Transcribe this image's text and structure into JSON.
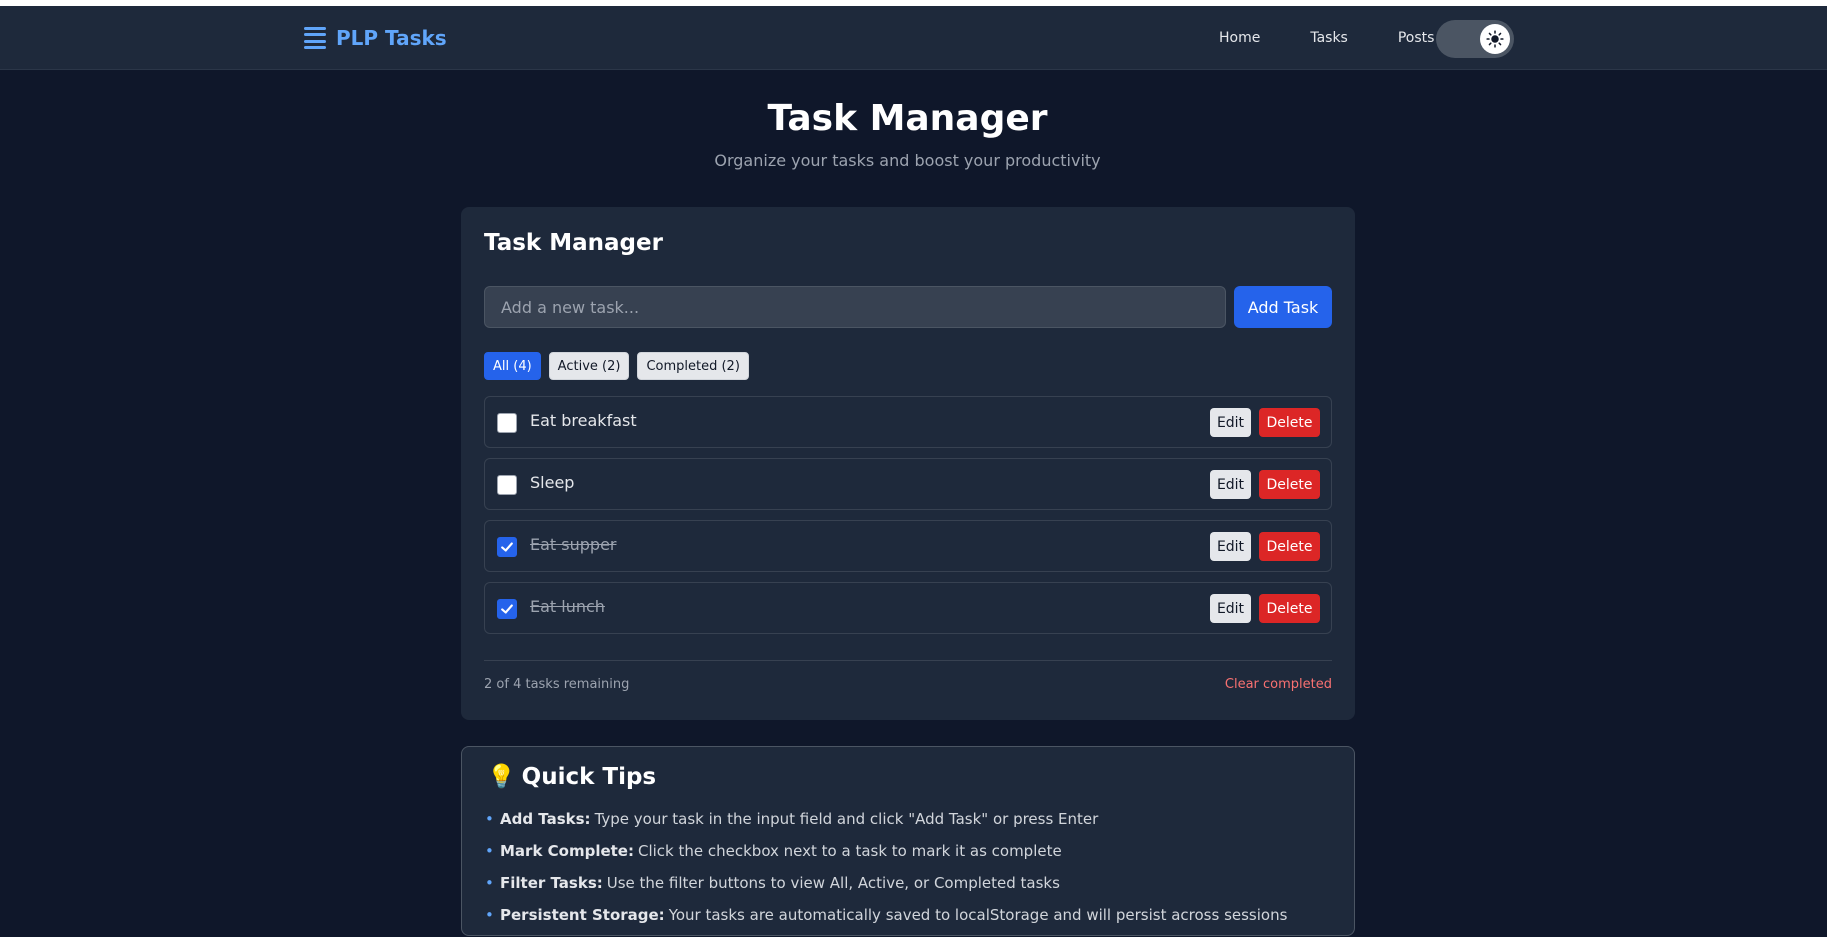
{
  "nav": {
    "brand": "PLP Tasks",
    "links": [
      "Home",
      "Tasks",
      "Posts"
    ],
    "theme_toggle_state": "light-mode-icon"
  },
  "hero": {
    "title": "Task Manager",
    "subtitle": "Organize your tasks and boost your productivity"
  },
  "task_card": {
    "title": "Task Manager",
    "input_placeholder": "Add a new task...",
    "input_value": "",
    "add_button": "Add Task",
    "filters": [
      {
        "label": "All (4)",
        "active": true
      },
      {
        "label": "Active (2)",
        "active": false
      },
      {
        "label": "Completed (2)",
        "active": false
      }
    ],
    "tasks": [
      {
        "text": "Eat breakfast",
        "completed": false,
        "edit": "Edit",
        "delete": "Delete"
      },
      {
        "text": "Sleep",
        "completed": false,
        "edit": "Edit",
        "delete": "Delete"
      },
      {
        "text": "Eat supper",
        "completed": true,
        "edit": "Edit",
        "delete": "Delete"
      },
      {
        "text": "Eat lunch",
        "completed": true,
        "edit": "Edit",
        "delete": "Delete"
      }
    ],
    "remaining_text": "2 of 4 tasks remaining",
    "clear_completed": "Clear completed"
  },
  "tips": {
    "icon": "💡",
    "title": "Quick Tips",
    "items": [
      {
        "label": "Add Tasks:",
        "text": "Type your task in the input field and click \"Add Task\" or press Enter"
      },
      {
        "label": "Mark Complete:",
        "text": "Click the checkbox next to a task to mark it as complete"
      },
      {
        "label": "Filter Tasks:",
        "text": "Use the filter buttons to view All, Active, or Completed tasks"
      },
      {
        "label": "Persistent Storage:",
        "text": "Your tasks are automatically saved to localStorage and will persist across sessions"
      }
    ]
  },
  "colors": {
    "background": "#0f172a",
    "card": "#1e293b",
    "accent": "#2563eb",
    "danger": "#dc2626",
    "brand": "#60a5fa"
  }
}
